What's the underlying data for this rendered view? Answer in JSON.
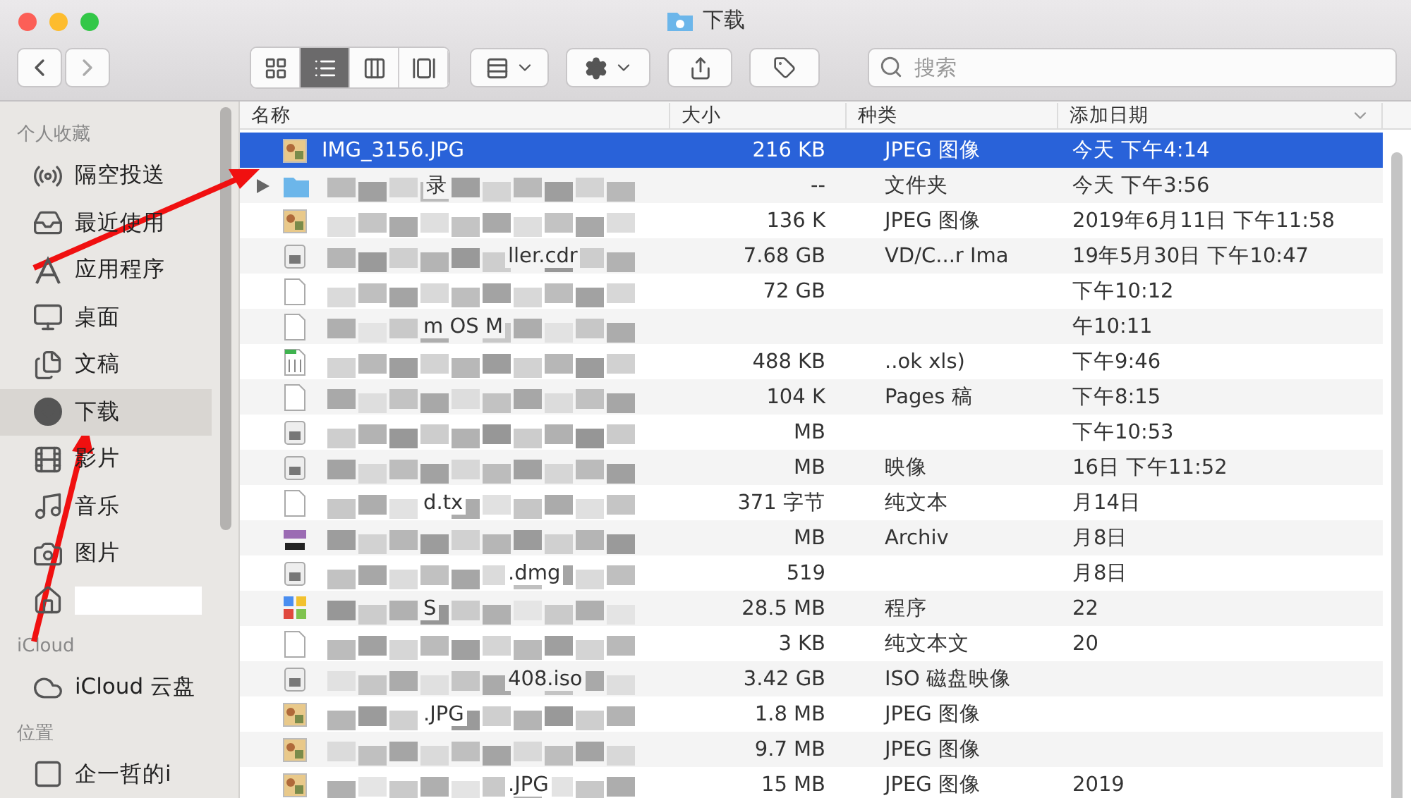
{
  "window": {
    "title": "下载"
  },
  "toolbar": {
    "views": [
      {
        "kind": "icons",
        "selected": false
      },
      {
        "kind": "list",
        "selected": true
      },
      {
        "kind": "columns",
        "selected": false
      },
      {
        "kind": "gallery",
        "selected": false
      }
    ],
    "search": {
      "placeholder": "搜索"
    }
  },
  "sidebar": {
    "sections": [
      {
        "title": "个人收藏",
        "items": [
          {
            "label": "隔空投送",
            "selected": false
          },
          {
            "label": "最近使用",
            "selected": false
          },
          {
            "label": "应用程序",
            "selected": false
          },
          {
            "label": "桌面",
            "selected": false
          },
          {
            "label": "文稿",
            "selected": false
          },
          {
            "label": "下载",
            "selected": true
          },
          {
            "label": "影片",
            "selected": false
          },
          {
            "label": "音乐",
            "selected": false
          },
          {
            "label": "图片",
            "selected": false
          },
          {
            "selected": false
          }
        ]
      },
      {
        "title": "iCloud",
        "items": [
          {
            "label": "iCloud 云盘",
            "selected": false
          }
        ]
      },
      {
        "title": "位置",
        "items": [
          {
            "label": "企一哲的i",
            "selected": false
          }
        ]
      }
    ]
  },
  "table": {
    "columns": [
      "名称",
      "大小",
      "种类",
      "添加日期"
    ],
    "rows": [
      {
        "kind": "image",
        "name": "IMG_3156.JPG",
        "size": "216 KB",
        "type": "JPEG 图像",
        "date": "今天 下午4:14",
        "selected": true,
        "blurred": false
      },
      {
        "kind": "folder",
        "name": "录",
        "size": "--",
        "type": "文件夹",
        "date": "今天 下午3:56",
        "selected": false,
        "blurred": true
      },
      {
        "kind": "image",
        "size": "136 K",
        "type": "JPEG 图像",
        "date": "2019年6月11日 下午11:58",
        "selected": false,
        "blurred": true
      },
      {
        "kind": "disk",
        "name": "ller.cdr",
        "size": "7.68 GB",
        "type": "VD/C...r Ima",
        "date": "19年5月30日 下午10:47",
        "selected": false,
        "blurred": true
      },
      {
        "kind": "doc",
        "size": "72 GB",
        "date": "下午10:12",
        "selected": false,
        "blurred": true
      },
      {
        "kind": "doc",
        "name": "m OS M",
        "date": "午10:11",
        "selected": false,
        "blurred": true
      },
      {
        "kind": "sheet",
        "size": "488 KB",
        "type": "..ok xls)",
        "date": "下午9:46",
        "selected": false,
        "blurred": true
      },
      {
        "kind": "doc",
        "size": "104 K",
        "type": "Pages 稿",
        "date": "下午8:15",
        "selected": false,
        "blurred": true
      },
      {
        "kind": "disk",
        "size": "MB",
        "date": "下午10:53",
        "selected": false,
        "blurred": true
      },
      {
        "kind": "disk",
        "size": "MB",
        "type": "映像",
        "date": "16日 下午11:52",
        "selected": false,
        "blurred": true
      },
      {
        "kind": "doc",
        "name": "d.tx",
        "size": "371 字节",
        "type": "纯文本",
        "date": "月14日",
        "selected": false,
        "blurred": true
      },
      {
        "kind": "archive",
        "size": "MB",
        "type": "Archiv",
        "date": "月8日",
        "selected": false,
        "blurred": true
      },
      {
        "kind": "disk",
        "name": ".dmg",
        "size": "519",
        "date": "月8日",
        "selected": false,
        "blurred": true
      },
      {
        "kind": "app",
        "name": "S",
        "size": "28.5 MB",
        "type": "程序",
        "date": "22",
        "selected": false,
        "blurred": true
      },
      {
        "kind": "doc",
        "size": "3 KB",
        "type": "纯文本文",
        "date": "20",
        "selected": false,
        "blurred": true
      },
      {
        "kind": "disk",
        "name": "408.iso",
        "size": "3.42 GB",
        "type": "ISO 磁盘映像",
        "selected": false,
        "blurred": true
      },
      {
        "kind": "image",
        "name": ".JPG",
        "size": "1.8 MB",
        "type": "JPEG 图像",
        "selected": false,
        "blurred": true
      },
      {
        "kind": "image",
        "size": "9.7 MB",
        "type": "JPEG 图像",
        "selected": false,
        "blurred": true
      },
      {
        "kind": "image",
        "name": ".JPG",
        "size": "15 MB",
        "type": "JPEG 图像",
        "date": "2019",
        "selected": false,
        "blurred": true
      }
    ]
  }
}
